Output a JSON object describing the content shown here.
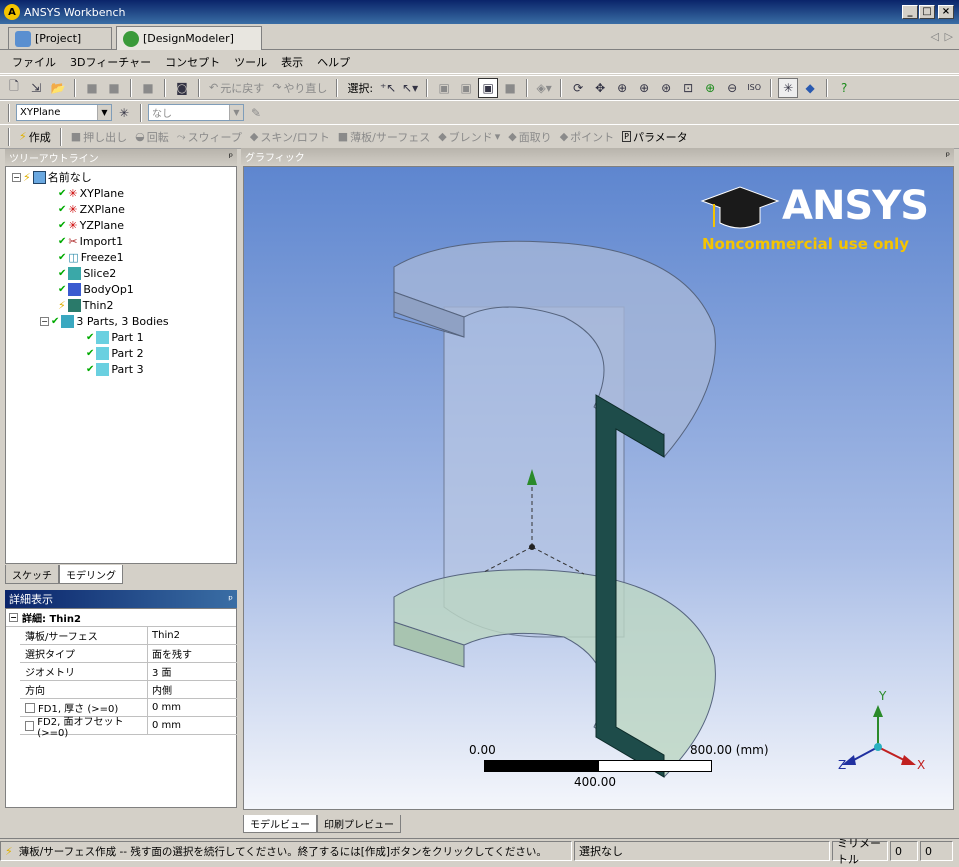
{
  "window": {
    "title": "ANSYS Workbench"
  },
  "tabs": [
    {
      "label": "[Project]"
    },
    {
      "label": "[DesignModeler]"
    }
  ],
  "menu": [
    "ファイル",
    "3Dフィーチャー",
    "コンセプト",
    "ツール",
    "表示",
    "ヘルプ"
  ],
  "toolbar1": {
    "undo": "元に戻す",
    "redo": "やり直し",
    "select": "選択:"
  },
  "toolbar2": {
    "plane": "XYPlane",
    "sketch": "なし"
  },
  "toolbar3": {
    "generate": "作成",
    "extrude": "押し出し",
    "revolve": "回転",
    "sweep": "スウィープ",
    "skin": "スキン/ロフト",
    "thin": "薄板/サーフェス",
    "blend": "ブレンド",
    "chamfer": "面取り",
    "point": "ポイント",
    "parameters": "パラメータ"
  },
  "tree": {
    "header": "ツリーアウトライン",
    "root": "名前なし",
    "items": [
      "XYPlane",
      "ZXPlane",
      "YZPlane",
      "Import1",
      "Freeze1",
      "Slice2",
      "BodyOp1",
      "Thin2"
    ],
    "parts_group": "3 Parts, 3 Bodies",
    "parts": [
      "Part 1",
      "Part 2",
      "Part 3"
    ]
  },
  "bottom_tabs": [
    "スケッチ",
    "モデリング"
  ],
  "details": {
    "header": "詳細表示",
    "title": "詳細: Thin2",
    "rows": [
      {
        "k": "薄板/サーフェス",
        "v": "Thin2"
      },
      {
        "k": "選択タイプ",
        "v": "面を残す"
      },
      {
        "k": "ジオメトリ",
        "v": "3 面"
      },
      {
        "k": "方向",
        "v": "内側"
      },
      {
        "k": "FD1, 厚さ (>=0)",
        "v": "0 mm"
      },
      {
        "k": "FD2, 面オフセット (>=0)",
        "v": "0 mm"
      }
    ]
  },
  "graphics": {
    "header": "グラフィック",
    "brand": "ANSYS",
    "brand_note": "Noncommercial use only",
    "scale": {
      "left": "0.00",
      "right": "800.00 (mm)",
      "mid": "400.00"
    },
    "axes": {
      "x": "X",
      "y": "Y",
      "z": "Z"
    }
  },
  "graphics_tabs": [
    "モデルビュー",
    "印刷プレビュー"
  ],
  "status": {
    "message": "薄板/サーフェス作成 -- 残す面の選択を続行してください。終了するには[作成]ボタンをクリックしてください。",
    "selection": "選択なし",
    "units": "ミリメートル",
    "v1": "0",
    "v2": "0"
  }
}
